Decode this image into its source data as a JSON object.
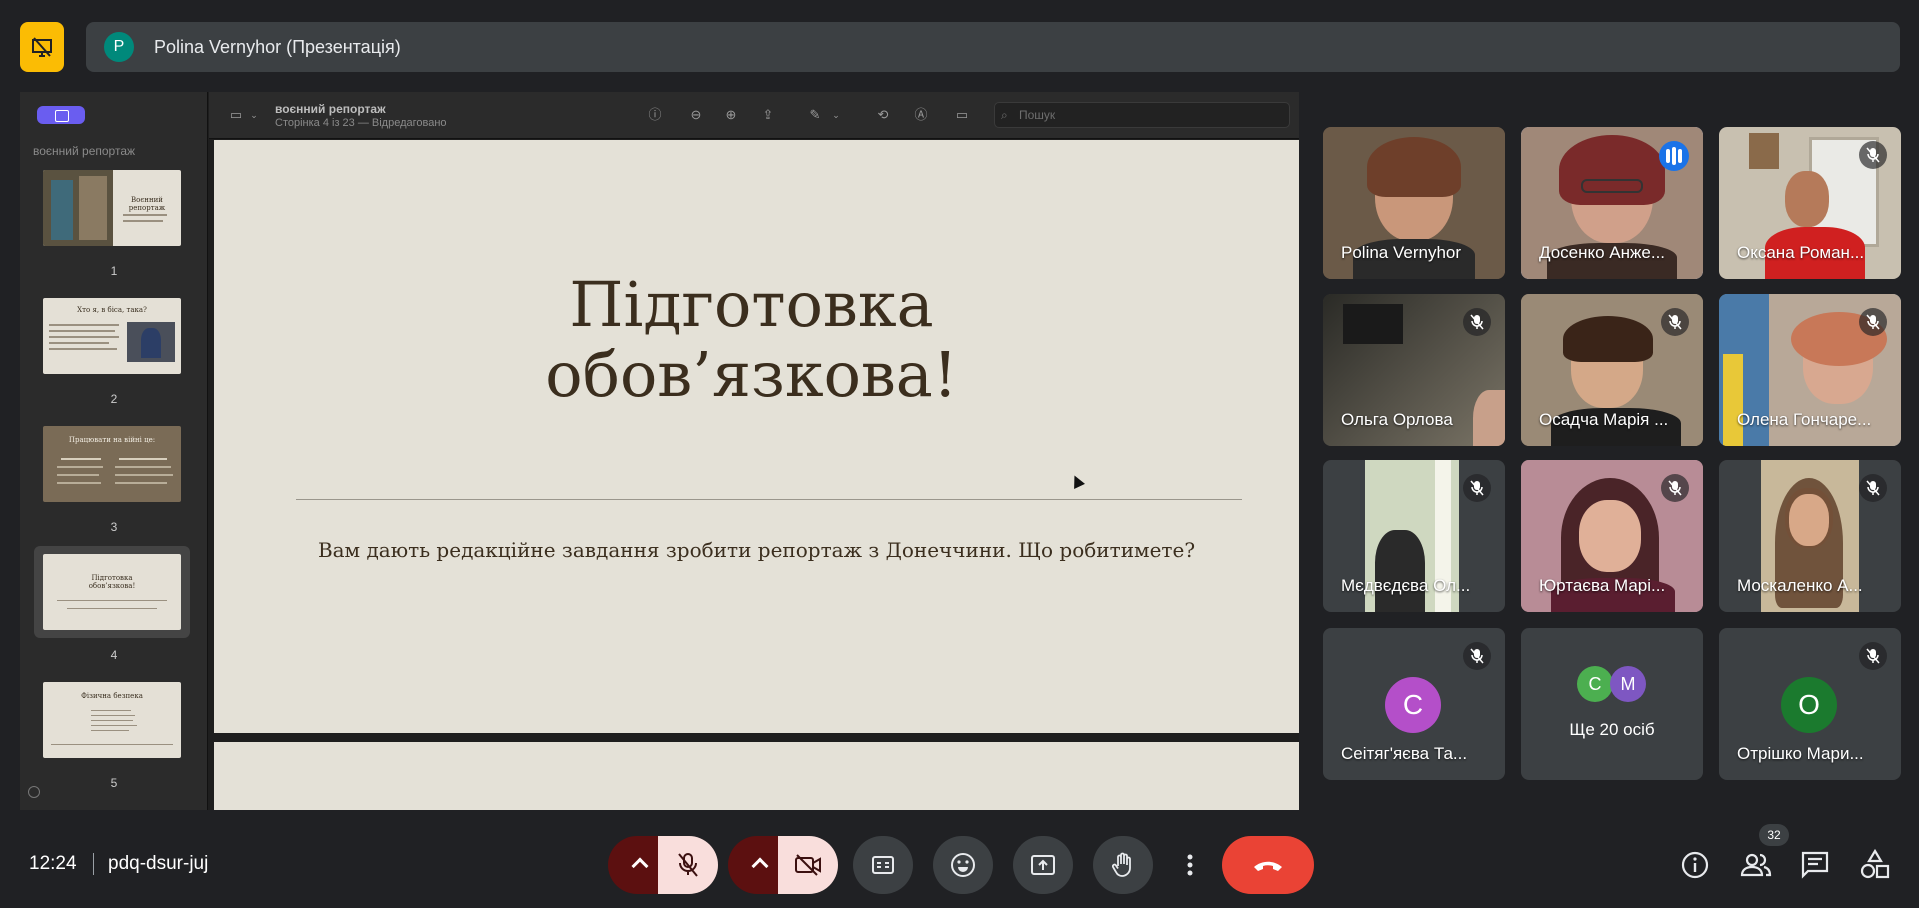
{
  "presenter": {
    "avatar_initial": "P",
    "label": "Polina Vernyhor (Презентація)"
  },
  "preview": {
    "sidebar_title": "воєнний репортаж",
    "doc_title": "воєнний репортаж",
    "doc_subtitle": "Сторінка 4 із 23 — Відредаговано",
    "search_placeholder": "Пошук",
    "thumbnails": [
      {
        "number": "1",
        "title": "Воєнний репортаж"
      },
      {
        "number": "2",
        "title": "Хто я, в біса, така?"
      },
      {
        "number": "3",
        "title": "Працювати на війні це:"
      },
      {
        "number": "4",
        "title": "Підготовка обов’язкова!"
      },
      {
        "number": "5",
        "title": "Фізична безпека"
      }
    ]
  },
  "slide": {
    "title": "Підготовка\nобов’язкова!",
    "body": "Вам дають редакційне завдання зробити репортаж з Донеччини. Що робитимете?"
  },
  "participants": [
    {
      "name": "Polina Vernyhor",
      "muted": false,
      "speaking": false
    },
    {
      "name": "Досенко Анже...",
      "muted": false,
      "speaking": true
    },
    {
      "name": "Оксана Роман...",
      "muted": true
    },
    {
      "name": "Ольга Орлова",
      "muted": true
    },
    {
      "name": "Осадча Марія ...",
      "muted": true
    },
    {
      "name": "Олена Гончаре...",
      "muted": true
    },
    {
      "name": "Мєдвєдєва Ол...",
      "muted": true
    },
    {
      "name": "Юртаєва Марі...",
      "muted": true
    },
    {
      "name": "Москаленко А...",
      "muted": true
    },
    {
      "name": "Сеітяг'яєва Та...",
      "muted": true,
      "initial": "С",
      "avatar_color": "#b44fc9"
    },
    {
      "name": "Ще 20 осіб",
      "initials": [
        "С",
        "М"
      ],
      "avatar_colors": [
        "#4caf50",
        "#7e57c2"
      ]
    },
    {
      "name": "Отрішко Мари...",
      "muted": true,
      "initial": "О",
      "avatar_color": "#1b7a2e"
    }
  ],
  "bottom": {
    "time": "12:24",
    "meeting_code": "pdq-dsur-juj",
    "people_count": "32"
  },
  "colors": {
    "accent_yellow": "#fbbc04",
    "end_call_red": "#ea4335",
    "active_speaker_outline": "#8ab4f8"
  }
}
